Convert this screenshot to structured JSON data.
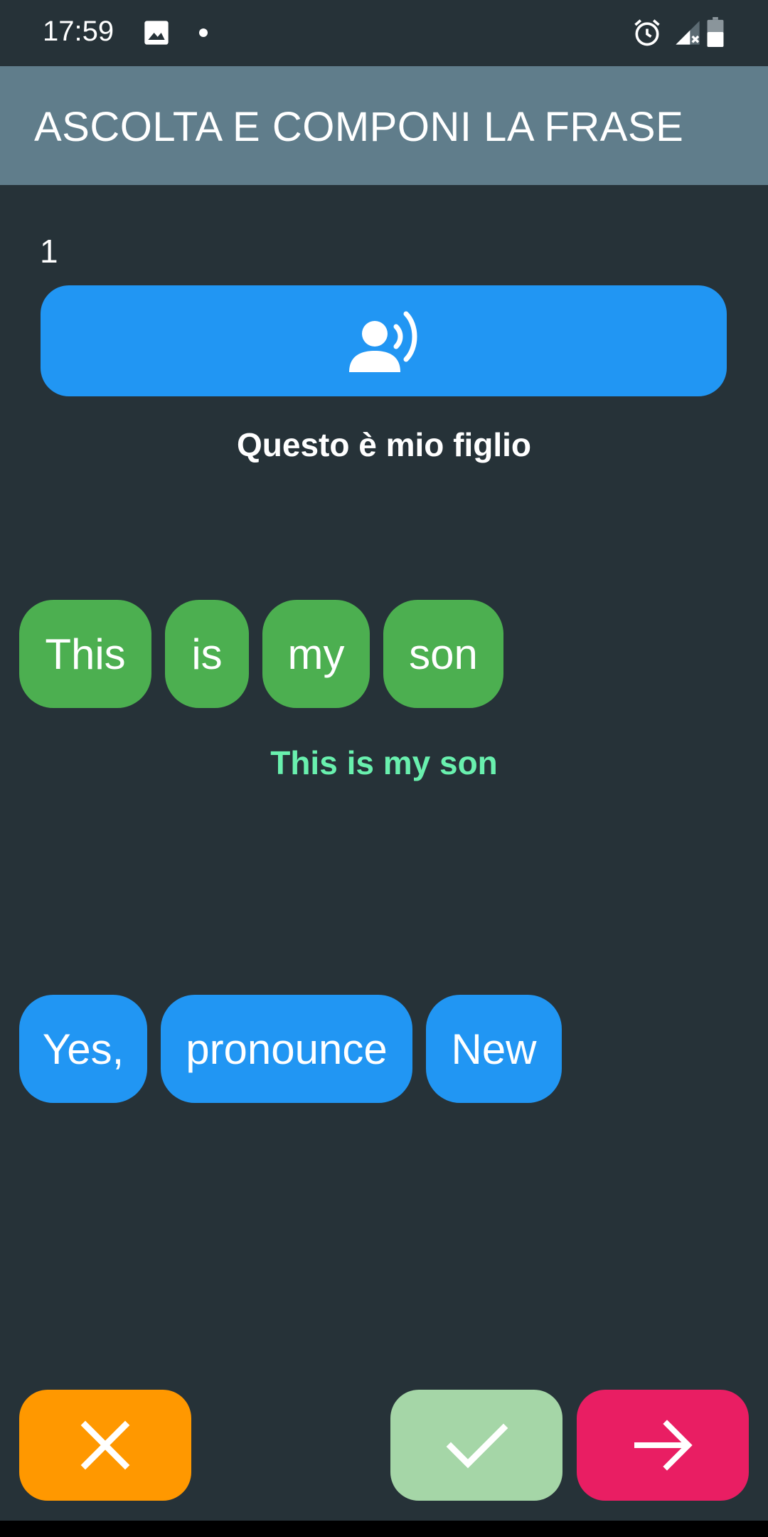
{
  "status_bar": {
    "time": "17:59",
    "icons": [
      "image-icon",
      "notification-dot",
      "alarm-icon",
      "signal-icon",
      "battery-icon"
    ]
  },
  "app_bar": {
    "title": "ASCOLTA E COMPONI LA FRASE"
  },
  "exercise": {
    "counter": "1",
    "speak_icon": "speaker-person-icon",
    "prompt": "Questo è mio figlio",
    "answer": "This is my son"
  },
  "selected_words": [
    "This",
    "is",
    "my",
    "son"
  ],
  "available_words": [
    "Yes,",
    "pronounce",
    "New"
  ],
  "actions": {
    "cancel_icon": "close-icon",
    "check_icon": "check-icon",
    "next_icon": "arrow-right-icon"
  },
  "colors": {
    "background": "#263238",
    "app_bar": "#607d8b",
    "primary_blue": "#2196f3",
    "chip_green": "#4caf50",
    "answer_green": "#69f0ae",
    "cancel_orange": "#ff9800",
    "check_light_green": "#a5d6a7",
    "next_pink": "#e91e63"
  }
}
